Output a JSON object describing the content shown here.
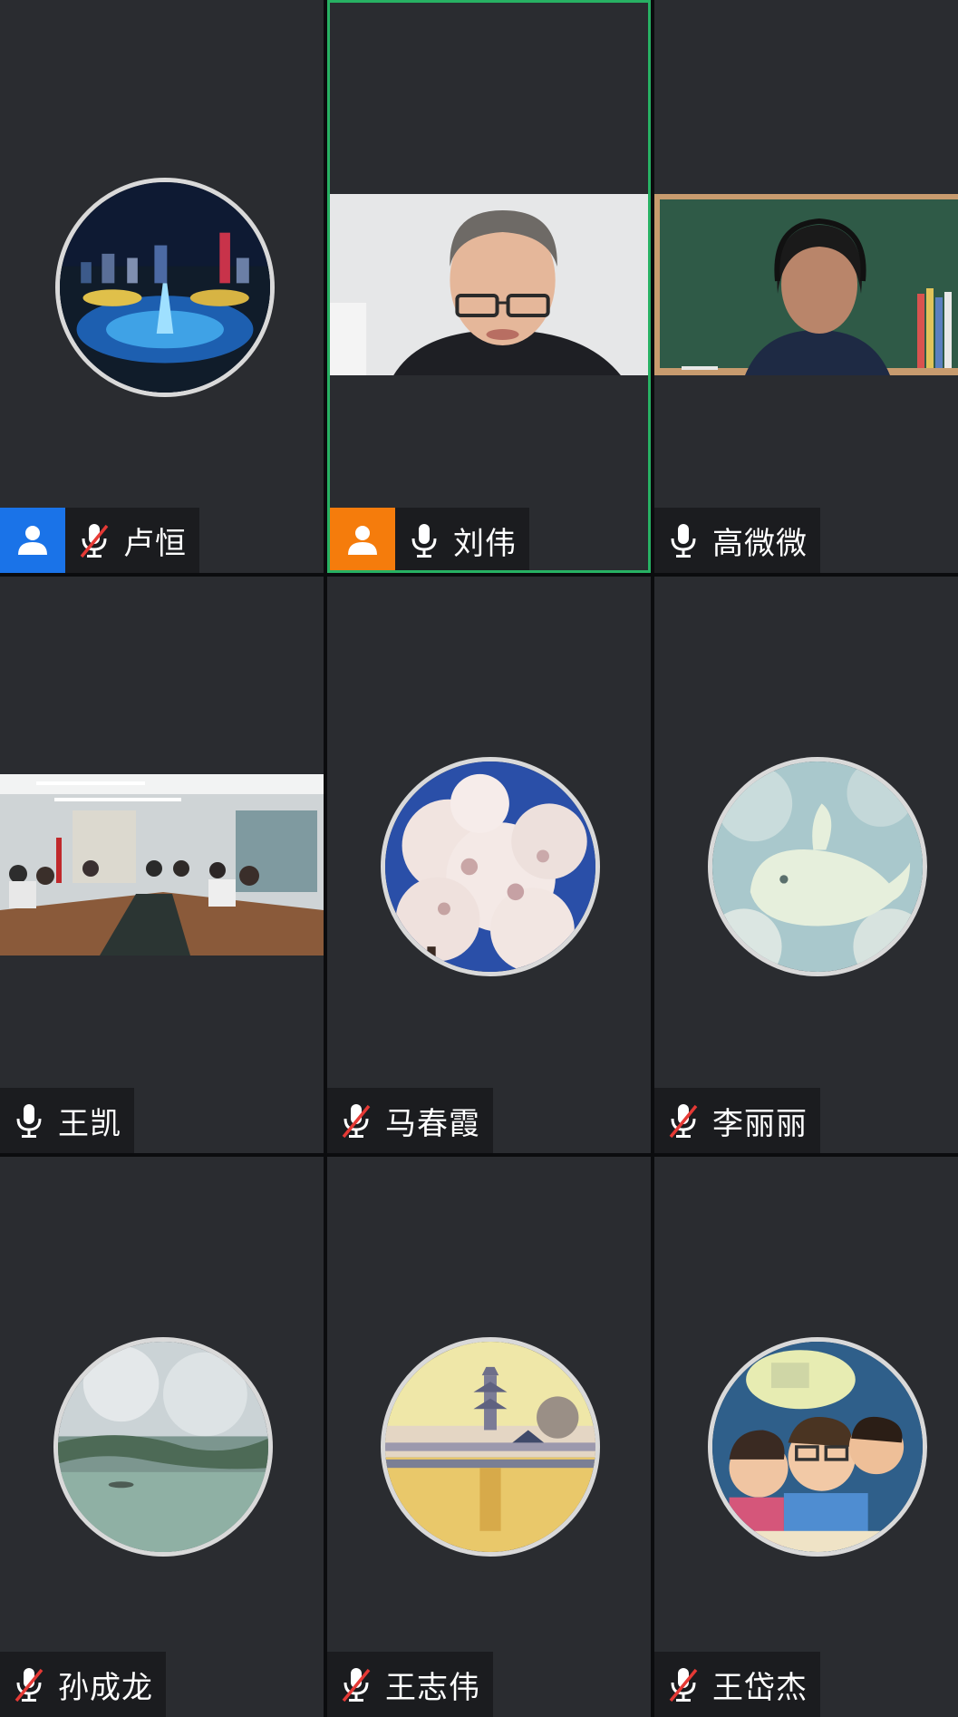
{
  "participants": [
    {
      "name": "卢恒",
      "mic": "muted",
      "host_badge": "blue",
      "feed": "avatar",
      "avatar_art": "city-night"
    },
    {
      "name": "刘伟",
      "mic": "on",
      "host_badge": "orange",
      "feed": "video",
      "video_art": "man-glasses",
      "active_speaker": true
    },
    {
      "name": "高微微",
      "mic": "on",
      "host_badge": null,
      "feed": "video",
      "video_art": "woman-blackboard"
    },
    {
      "name": "王凯",
      "mic": "on",
      "host_badge": null,
      "feed": "video",
      "video_art": "conference-room"
    },
    {
      "name": "马春霞",
      "mic": "muted",
      "host_badge": null,
      "feed": "avatar",
      "avatar_art": "cherry-blossoms"
    },
    {
      "name": "李丽丽",
      "mic": "muted",
      "host_badge": null,
      "feed": "avatar",
      "avatar_art": "cloud-whale"
    },
    {
      "name": "孙成龙",
      "mic": "muted",
      "host_badge": null,
      "feed": "avatar",
      "avatar_art": "lake-aerial"
    },
    {
      "name": "王志伟",
      "mic": "muted",
      "host_badge": null,
      "feed": "avatar",
      "avatar_art": "pagoda-sunset"
    },
    {
      "name": "王岱杰",
      "mic": "muted",
      "host_badge": null,
      "feed": "avatar",
      "avatar_art": "cartoon-kids"
    }
  ],
  "colors": {
    "tile_bg": "#2a2c30",
    "active_border": "#27b163",
    "host_blue": "#1a73e8",
    "cohost_orange": "#f57c0c",
    "muted_slash": "#e53935"
  }
}
